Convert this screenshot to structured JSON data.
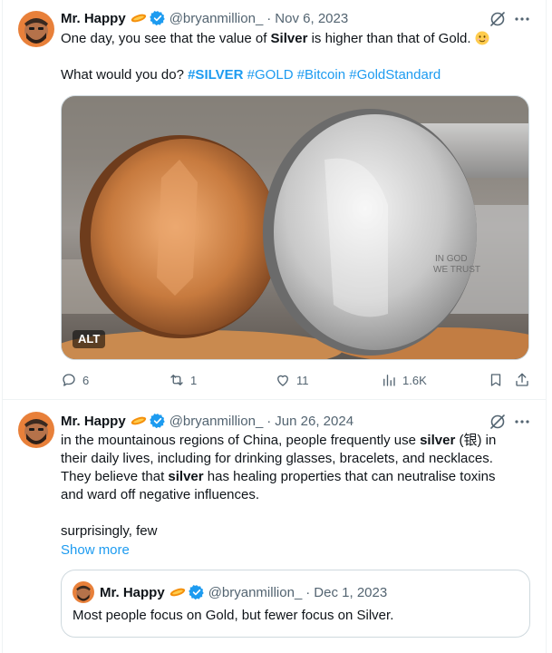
{
  "tweets": [
    {
      "author_name": "Mr. Happy",
      "handle": "@bryanmillion_",
      "separator": "·",
      "date": "Nov 6, 2023",
      "text_line1_a": "One day, you see that the value of ",
      "text_line1_bold": "Silver",
      "text_line1_b": " is higher than that of Gold.",
      "text_line2_plain": "What would you do? ",
      "hashtags": [
        "#SILVER",
        "#GOLD",
        "#Bitcoin",
        "#GoldStandard"
      ],
      "media_alt_badge": "ALT",
      "media_description_icon": "coins-photo",
      "stats": {
        "replies": "6",
        "reposts": "1",
        "likes": "11",
        "views": "1.6K"
      }
    },
    {
      "author_name": "Mr. Happy",
      "handle": "@bryanmillion_",
      "separator": "·",
      "date": "Jun 26, 2024",
      "p1_a": "in the mountainous regions of China, people frequently use ",
      "p1_bold": "silver",
      "p1_b": " (银) in their daily lives, including for drinking glasses, bracelets, and necklaces. They believe that ",
      "p1_bold2": "silver",
      "p1_c": " has healing properties that can neutralise toxins and ward off negative influences.",
      "p2": "surprisingly, few",
      "show_more": "Show more",
      "quote": {
        "author_name": "Mr. Happy",
        "handle": "@bryanmillion_",
        "separator": "·",
        "date": "Dec 1, 2023",
        "text": "Most people focus on Gold, but fewer focus on Silver."
      }
    }
  ],
  "colors": {
    "link": "#1d9bf0",
    "muted": "#536471",
    "border": "#cfd9de",
    "verified": "#1d9bf0"
  }
}
